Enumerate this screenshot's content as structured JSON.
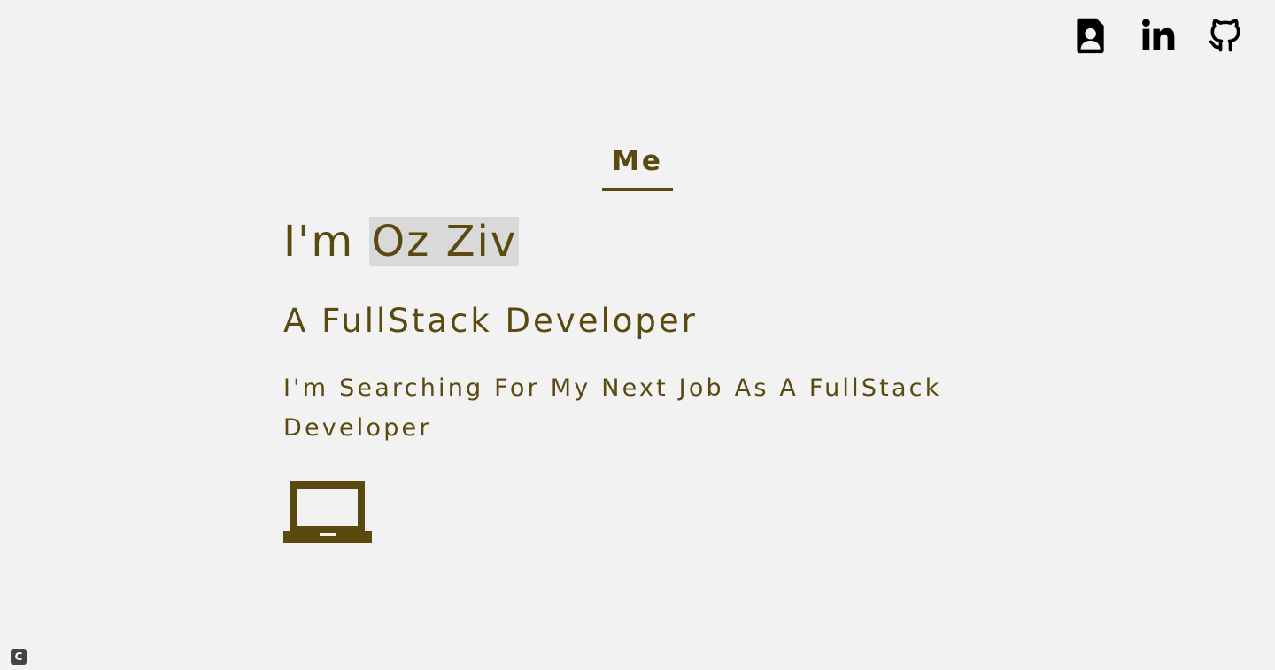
{
  "header": {
    "links": [
      {
        "name": "resume",
        "icon": "contact-file-icon"
      },
      {
        "name": "linkedin",
        "icon": "linkedin-icon"
      },
      {
        "name": "github",
        "icon": "github-icon"
      }
    ]
  },
  "tab": {
    "label": "Me"
  },
  "hero": {
    "intro_prefix": "I'm ",
    "name": "Oz Ziv",
    "role": "A FullStack Developer",
    "description": "I'm Searching For My Next Job As A FullStack Developer",
    "icon": "laptop-icon"
  },
  "footer": {
    "copyright_symbol": "C"
  },
  "colors": {
    "accent": "#5a4a10",
    "background": "#f2f2f2",
    "highlight": "#d9d9d9"
  }
}
